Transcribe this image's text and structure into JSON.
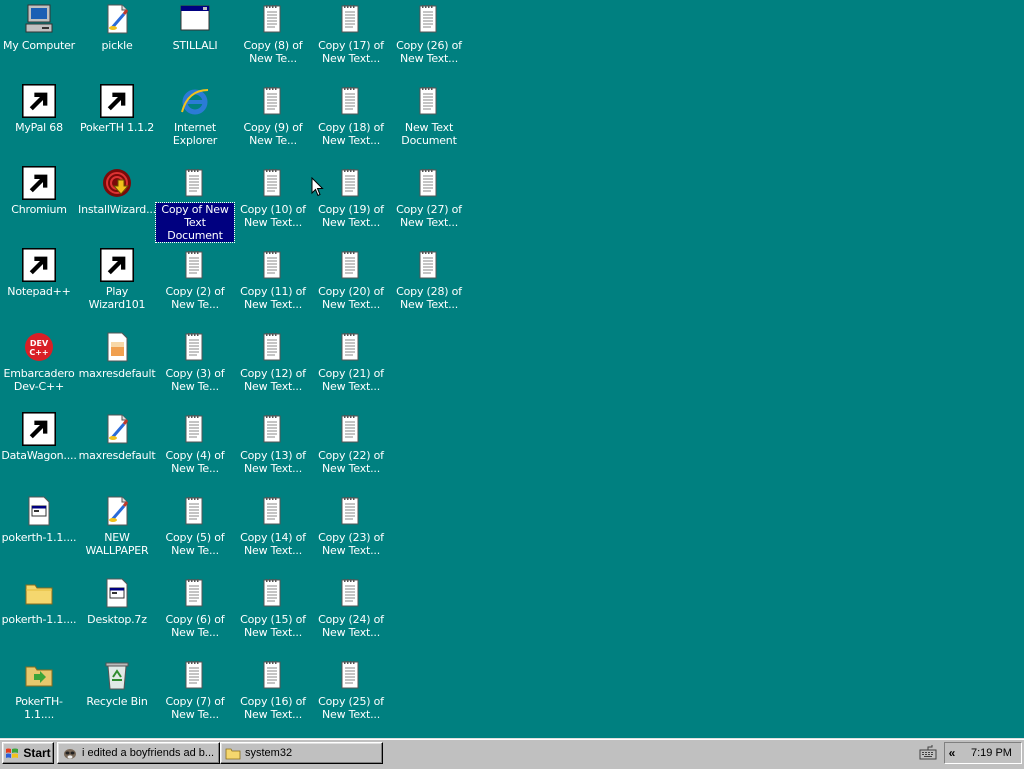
{
  "desktop": {
    "icons": [
      {
        "label": "My Computer",
        "icon": "my-computer-icon",
        "shortcut": false
      },
      {
        "label": "MyPal 68",
        "icon": "raccoon-icon",
        "shortcut": true
      },
      {
        "label": "Chromium",
        "icon": "chromium-icon",
        "shortcut": true
      },
      {
        "label": "Notepad++",
        "icon": "notepad-plus-icon",
        "shortcut": true
      },
      {
        "label": "Embarcadero Dev-C++",
        "icon": "devcpp-icon",
        "shortcut": false
      },
      {
        "label": "DataWagon....",
        "icon": "datawagon-icon",
        "shortcut": true
      },
      {
        "label": "pokerth-1.1....",
        "icon": "setup-file-icon",
        "shortcut": false
      },
      {
        "label": "pokerth-1.1....",
        "icon": "folder-icon",
        "shortcut": false
      },
      {
        "label": "PokerTH-1.1....",
        "icon": "archive-icon",
        "shortcut": false
      },
      {
        "label": "pickle",
        "icon": "paint-file-icon",
        "shortcut": false
      },
      {
        "label": "PokerTH 1.1.2",
        "icon": "pokerth-icon",
        "shortcut": true
      },
      {
        "label": "InstallWizard...",
        "icon": "wizard-install-icon",
        "shortcut": false
      },
      {
        "label": "Play Wizard101",
        "icon": "wizard101-icon",
        "shortcut": true
      },
      {
        "label": "maxresdefault",
        "icon": "image-file-icon",
        "shortcut": false
      },
      {
        "label": "maxresdefault",
        "icon": "paint-file-icon",
        "shortcut": false
      },
      {
        "label": "NEW WALLPAPER",
        "icon": "paint-file-icon",
        "shortcut": false
      },
      {
        "label": "Desktop.7z",
        "icon": "setup-file-icon",
        "shortcut": false
      },
      {
        "label": "Recycle Bin",
        "icon": "recycle-bin-icon",
        "shortcut": false
      },
      {
        "label": "STILLALI",
        "icon": "window-app-icon",
        "shortcut": false
      },
      {
        "label": "Internet Explorer",
        "icon": "internet-explorer-icon",
        "shortcut": false
      },
      {
        "label": "Copy of New Text Document",
        "icon": "text-document-icon",
        "shortcut": false,
        "selected": true
      },
      {
        "label": "Copy (2) of New Te...",
        "icon": "text-document-icon",
        "shortcut": false
      },
      {
        "label": "Copy (3) of New Te...",
        "icon": "text-document-icon",
        "shortcut": false
      },
      {
        "label": "Copy (4) of New Te...",
        "icon": "text-document-icon",
        "shortcut": false
      },
      {
        "label": "Copy (5) of New Te...",
        "icon": "text-document-icon",
        "shortcut": false
      },
      {
        "label": "Copy (6) of New Te...",
        "icon": "text-document-icon",
        "shortcut": false
      },
      {
        "label": "Copy (7) of New Te...",
        "icon": "text-document-icon",
        "shortcut": false
      },
      {
        "label": "Copy (8) of New Te...",
        "icon": "text-document-icon",
        "shortcut": false
      },
      {
        "label": "Copy (9) of New Te...",
        "icon": "text-document-icon",
        "shortcut": false
      },
      {
        "label": "Copy (10) of New Text...",
        "icon": "text-document-icon",
        "shortcut": false
      },
      {
        "label": "Copy (11) of New Text...",
        "icon": "text-document-icon",
        "shortcut": false
      },
      {
        "label": "Copy (12) of New Text...",
        "icon": "text-document-icon",
        "shortcut": false
      },
      {
        "label": "Copy (13) of New Text...",
        "icon": "text-document-icon",
        "shortcut": false
      },
      {
        "label": "Copy (14) of New Text...",
        "icon": "text-document-icon",
        "shortcut": false
      },
      {
        "label": "Copy (15) of New Text...",
        "icon": "text-document-icon",
        "shortcut": false
      },
      {
        "label": "Copy (16) of New Text...",
        "icon": "text-document-icon",
        "shortcut": false
      },
      {
        "label": "Copy (17) of New Text...",
        "icon": "text-document-icon",
        "shortcut": false
      },
      {
        "label": "Copy (18) of New Text...",
        "icon": "text-document-icon",
        "shortcut": false
      },
      {
        "label": "Copy (19) of New Text...",
        "icon": "text-document-icon",
        "shortcut": false
      },
      {
        "label": "Copy (20) of New Text...",
        "icon": "text-document-icon",
        "shortcut": false
      },
      {
        "label": "Copy (21) of New Text...",
        "icon": "text-document-icon",
        "shortcut": false
      },
      {
        "label": "Copy (22) of New Text...",
        "icon": "text-document-icon",
        "shortcut": false
      },
      {
        "label": "Copy (23) of New Text...",
        "icon": "text-document-icon",
        "shortcut": false
      },
      {
        "label": "Copy (24) of New Text...",
        "icon": "text-document-icon",
        "shortcut": false
      },
      {
        "label": "Copy (25) of New Text...",
        "icon": "text-document-icon",
        "shortcut": false
      },
      {
        "label": "Copy (26) of New Text...",
        "icon": "text-document-icon",
        "shortcut": false
      },
      {
        "label": "New Text Document",
        "icon": "text-document-icon",
        "shortcut": false
      },
      {
        "label": "Copy (27) of New Text...",
        "icon": "text-document-icon",
        "shortcut": false
      },
      {
        "label": "Copy (28) of New Text...",
        "icon": "text-document-icon",
        "shortcut": false
      }
    ]
  },
  "taskbar": {
    "start_label": "Start",
    "tasks": [
      {
        "label": "i edited a boyfriends ad b...",
        "icon": "raccoon-icon"
      },
      {
        "label": "system32",
        "icon": "folder-icon"
      }
    ],
    "tray_chevron": "«",
    "clock": "7:19 PM"
  },
  "colors": {
    "desktop_bg": "#008080",
    "taskbar_bg": "#c0c0c0",
    "selection": "#000080"
  }
}
